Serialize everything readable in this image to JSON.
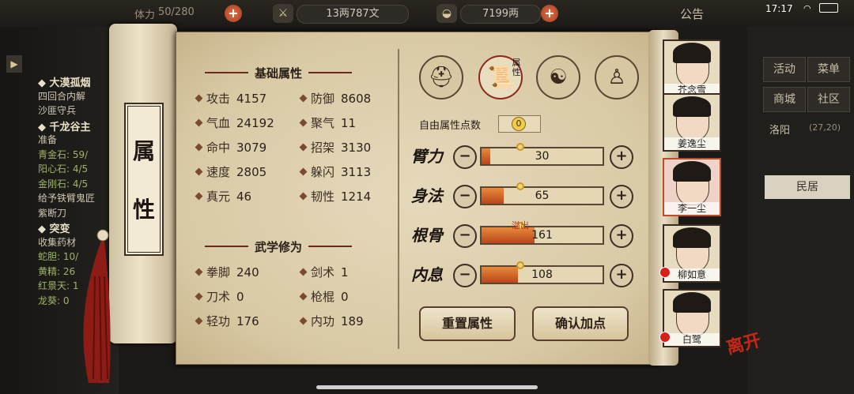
{
  "topbar": {
    "stamina_label": "体力",
    "stamina": "50/280",
    "silver": "13两787文",
    "gold": "7199两",
    "notice": "公告",
    "time": "17:17"
  },
  "left_quests": [
    {
      "text": "◆ 大漠孤烟",
      "style": "h"
    },
    {
      "text": "四回合内解",
      "style": ""
    },
    {
      "text": "沙匪守兵",
      "style": ""
    },
    {
      "text": "◆ 千龙谷主",
      "style": "h"
    },
    {
      "text": "准备",
      "style": ""
    },
    {
      "text": "青金石: 59/",
      "style": "g"
    },
    {
      "text": "阳心石: 4/5",
      "style": "g"
    },
    {
      "text": "金刚石: 4/5",
      "style": "g"
    },
    {
      "text": "给予铁臂鬼匠",
      "style": ""
    },
    {
      "text": "紫断刀",
      "style": ""
    },
    {
      "text": "◆ 突变",
      "style": "h"
    },
    {
      "text": "收集药材",
      "style": ""
    },
    {
      "text": "蛇胆: 10/",
      "style": "g"
    },
    {
      "text": "黄精: 26",
      "style": "g"
    },
    {
      "text": "红景天: 1",
      "style": "g"
    },
    {
      "text": "龙葵: 0",
      "style": "g"
    }
  ],
  "right_menu": {
    "activity": "活动",
    "menu": "菜单",
    "mall": "商城",
    "community": "社区",
    "location": "洛阳",
    "coords": "(27,20)",
    "residence": "民居"
  },
  "scroll_tag": [
    "属",
    "性"
  ],
  "basic": {
    "title": "基础属性",
    "stats": [
      {
        "name": "攻击",
        "value": "4157"
      },
      {
        "name": "防御",
        "value": "8608"
      },
      {
        "name": "气血",
        "value": "24192"
      },
      {
        "name": "聚气",
        "value": "11"
      },
      {
        "name": "命中",
        "value": "3079"
      },
      {
        "name": "招架",
        "value": "3130"
      },
      {
        "name": "速度",
        "value": "2805"
      },
      {
        "name": "躲闪",
        "value": "3113"
      },
      {
        "name": "真元",
        "value": "46"
      },
      {
        "name": "韧性",
        "value": "1214"
      }
    ]
  },
  "martial": {
    "title": "武学修为",
    "stats": [
      {
        "name": "拳脚",
        "value": "240"
      },
      {
        "name": "剑术",
        "value": "1"
      },
      {
        "name": "刀术",
        "value": "0"
      },
      {
        "name": "枪棍",
        "value": "0"
      },
      {
        "name": "轻功",
        "value": "176"
      },
      {
        "name": "内功",
        "value": "189"
      }
    ]
  },
  "tabs": {
    "attr_label": "属性"
  },
  "free_points": {
    "label": "自由属性点数",
    "value": "0"
  },
  "attributes": [
    {
      "name": "臂力",
      "value": "30",
      "fill": 0.07
    },
    {
      "name": "身法",
      "value": "65",
      "fill": 0.18
    },
    {
      "name": "根骨",
      "value": "161",
      "fill": 0.44
    },
    {
      "name": "内息",
      "value": "108",
      "fill": 0.3
    }
  ],
  "overflow_label": "溢出",
  "buttons": {
    "reset": "重置属性",
    "confirm": "确认加点"
  },
  "characters": [
    {
      "name": "芥念雪"
    },
    {
      "name": "姜逸尘"
    },
    {
      "name": "李一尘"
    },
    {
      "name": "柳如意"
    },
    {
      "name": "白鹭"
    }
  ],
  "leave_label": "离开",
  "colors": {
    "accent": "#a8321e",
    "bar_fill": "#d86a2a",
    "panel": "#e3d5b4"
  }
}
